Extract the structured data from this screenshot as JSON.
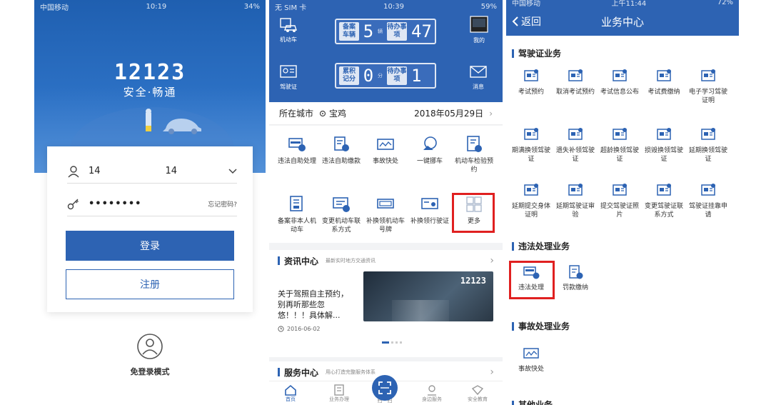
{
  "colors": {
    "brand_blue": "#2d63b3",
    "highlight_red": "#e02020"
  },
  "login": {
    "status_left": "中国移动",
    "status_time": "10:19",
    "status_battery": "34%",
    "app_logo": "12123",
    "slogan": "安全·畅通",
    "username_value": "14                      14",
    "password_value": "••••••••",
    "forgot_password": "忘记密码?",
    "login_button": "登录",
    "register_button": "注册",
    "guest_mode": "免登录模式"
  },
  "home": {
    "status_left": "无 SIM 卡",
    "status_time": "10:39",
    "status_battery": "59%",
    "side_left": [
      {
        "label": "机动车",
        "icon": "car-icon"
      },
      {
        "label": "驾驶证",
        "icon": "license-icon"
      }
    ],
    "side_right": [
      {
        "label": "我的",
        "icon": "profile-icon"
      },
      {
        "label": "消息",
        "icon": "mail-icon"
      }
    ],
    "counter_vehicle": {
      "label": "备案车辆",
      "value": "5",
      "unit": "辆",
      "pending_label": "待办事项",
      "pending_value": "47"
    },
    "counter_license": {
      "label": "累积记分",
      "value": "0",
      "unit": "分",
      "pending_label": "待办事项",
      "pending_value": "1"
    },
    "city_label": "所在城市",
    "city_value": "宝鸡",
    "date": "2018年05月29日",
    "services": [
      {
        "label": "违法自助处理",
        "icon": "violation-icon"
      },
      {
        "label": "违法自助缴款",
        "icon": "payment-icon"
      },
      {
        "label": "事故快处",
        "icon": "accident-icon"
      },
      {
        "label": "一键挪车",
        "icon": "move-car-icon"
      },
      {
        "label": "机动车检验预约",
        "icon": "inspection-icon"
      },
      {
        "label": "备案非本人机动车",
        "icon": "register-car-icon"
      },
      {
        "label": "变更机动车联系方式",
        "icon": "contact-icon"
      },
      {
        "label": "补换领机动车号牌",
        "icon": "plate-icon"
      },
      {
        "label": "补换领行驶证",
        "icon": "driving-permit-icon"
      },
      {
        "label": "更多",
        "icon": "more-icon"
      }
    ],
    "news_title": "资讯中心",
    "news_sub": "最新实时地方交通资讯",
    "news_text": "关于驾照自主预约，别再听那些忽悠！！！具体解...",
    "news_date": "2016-06-02",
    "news_image_text": "12123",
    "service_title": "服务中心",
    "service_sub": "用心打造完整服务体系",
    "tabs": [
      {
        "label": "首页"
      },
      {
        "label": "业务办理"
      },
      {
        "label": "扫一扫"
      },
      {
        "label": "身边服务"
      },
      {
        "label": "安全教育"
      }
    ]
  },
  "business": {
    "status_left": "中国移动",
    "status_time": "上午11:44",
    "status_battery": "72%",
    "back": "返回",
    "title": "业务中心",
    "license_section": "驾驶证业务",
    "license_items": [
      {
        "label": "考试预约"
      },
      {
        "label": "取消考试预约"
      },
      {
        "label": "考试信息公布"
      },
      {
        "label": "考试费缴纳"
      },
      {
        "label": "电子学习驾驶证明"
      },
      {
        "label": "期满换领驾驶证"
      },
      {
        "label": "遗失补领驾驶证"
      },
      {
        "label": "超龄换领驾驶证"
      },
      {
        "label": "损毁换领驾驶证"
      },
      {
        "label": "延期换领驾驶证"
      },
      {
        "label": "延期提交身体证明"
      },
      {
        "label": "延期驾驶证审验"
      },
      {
        "label": "提交驾驶证照片"
      },
      {
        "label": "变更驾驶证联系方式"
      },
      {
        "label": "驾驶证挂靠申请"
      }
    ],
    "violation_section": "违法处理业务",
    "violation_items": [
      {
        "label": "违法处理"
      },
      {
        "label": "罚款缴纳"
      }
    ],
    "accident_section": "事故处理业务",
    "accident_items": [
      {
        "label": "事故快处"
      }
    ],
    "other_section": "其他业务"
  }
}
